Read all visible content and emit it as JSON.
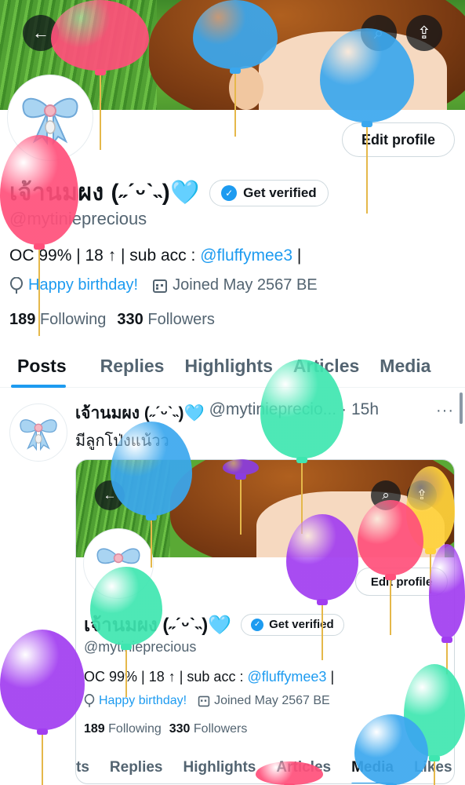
{
  "profile": {
    "display_name": "เจ้านมผง (˶ˊᵕˋ˵)",
    "heart_emoji": "🩵",
    "handle": "@mytiniepreciouş",
    "handle_clean": "@mytinieprecious",
    "get_verified": "Get verified",
    "edit_profile": "Edit profile",
    "bio_prefix": "OC 99% | 18 ↑ | sub acc : ",
    "bio_link": "@fluffymee3",
    "bio_suffix": " |",
    "birthday": "Happy birthday!",
    "joined": "Joined May 2567 BE",
    "following_count": "189",
    "following_label": "Following",
    "followers_count": "330",
    "followers_label": "Followers"
  },
  "tabs": [
    "Posts",
    "Replies",
    "Highlights",
    "Articles",
    "Media"
  ],
  "post": {
    "name": "เจ้านมผง (˶ˊᵕˋ˵)🩵",
    "handle": "@mytiniepreciо...",
    "time": "· 15h",
    "more": "···",
    "text": "มีลูกโป่งแน้วว"
  },
  "card": {
    "edit_profile": "Edit profile",
    "display_name": "เจ้านมผง (˶ˊᵕˋ˵)",
    "heart_emoji": "🩵",
    "get_verified": "Get verified",
    "handle": "@mytinieprecious",
    "bio_prefix": "OC 99% | 18 ↑ | sub acc : ",
    "bio_link": "@fluffymee3",
    "bio_suffix": " |",
    "birthday": "Happy birthday!",
    "joined": "Joined May 2567 BE",
    "following_count": "189",
    "following_label": "Following",
    "followers_count": "330",
    "followers_label": "Followers",
    "tabs": [
      "ts",
      "Replies",
      "Highlights",
      "Articles",
      "Media",
      "Likes"
    ]
  },
  "icons": {
    "back": "←",
    "search": "⌕",
    "share": "⇪",
    "badge": "✓",
    "balloon": "◯",
    "calendar": "▦"
  },
  "colors": {
    "accent": "#1d9bf0",
    "text": "#0f1419",
    "muted": "#536471"
  }
}
